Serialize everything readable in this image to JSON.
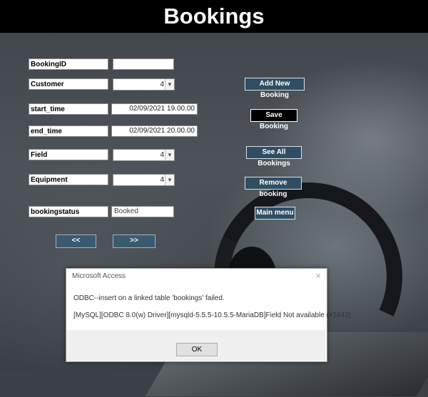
{
  "title": "Bookings",
  "form": {
    "booking_id": {
      "label": "BookingID",
      "value": ""
    },
    "customer": {
      "label": "Customer",
      "value": "4"
    },
    "start_time": {
      "label": "start_time",
      "value": "02/09/2021 19.00.00"
    },
    "end_time": {
      "label": "end_time",
      "value": "02/09/2021 20.00.00"
    },
    "field": {
      "label": "Field",
      "value": "4"
    },
    "equipment": {
      "label": "Equipment",
      "value": "4"
    },
    "booking_status": {
      "label": "bookingstatus",
      "value": "Booked"
    }
  },
  "buttons": {
    "add_new": "Add New Booking",
    "save": "Save Booking",
    "see_all": "See All Bookings",
    "remove": "Remove booking",
    "main_menu": "Main menu",
    "prev": "<<",
    "next": ">>"
  },
  "dialog": {
    "title": "Microsoft Access",
    "close": "×",
    "message1": "ODBC--insert on a linked table 'bookings' failed.",
    "message2": "[MySQL][ODBC 8.0(w) Driver][mysqld-5.5.5-10.5.5-MariaDB]Field Not available (#1643)",
    "ok": "OK"
  },
  "icons": {
    "dropdown": "chevron-down-icon"
  },
  "colors": {
    "header": "#000000",
    "button": "#2f4e63"
  }
}
